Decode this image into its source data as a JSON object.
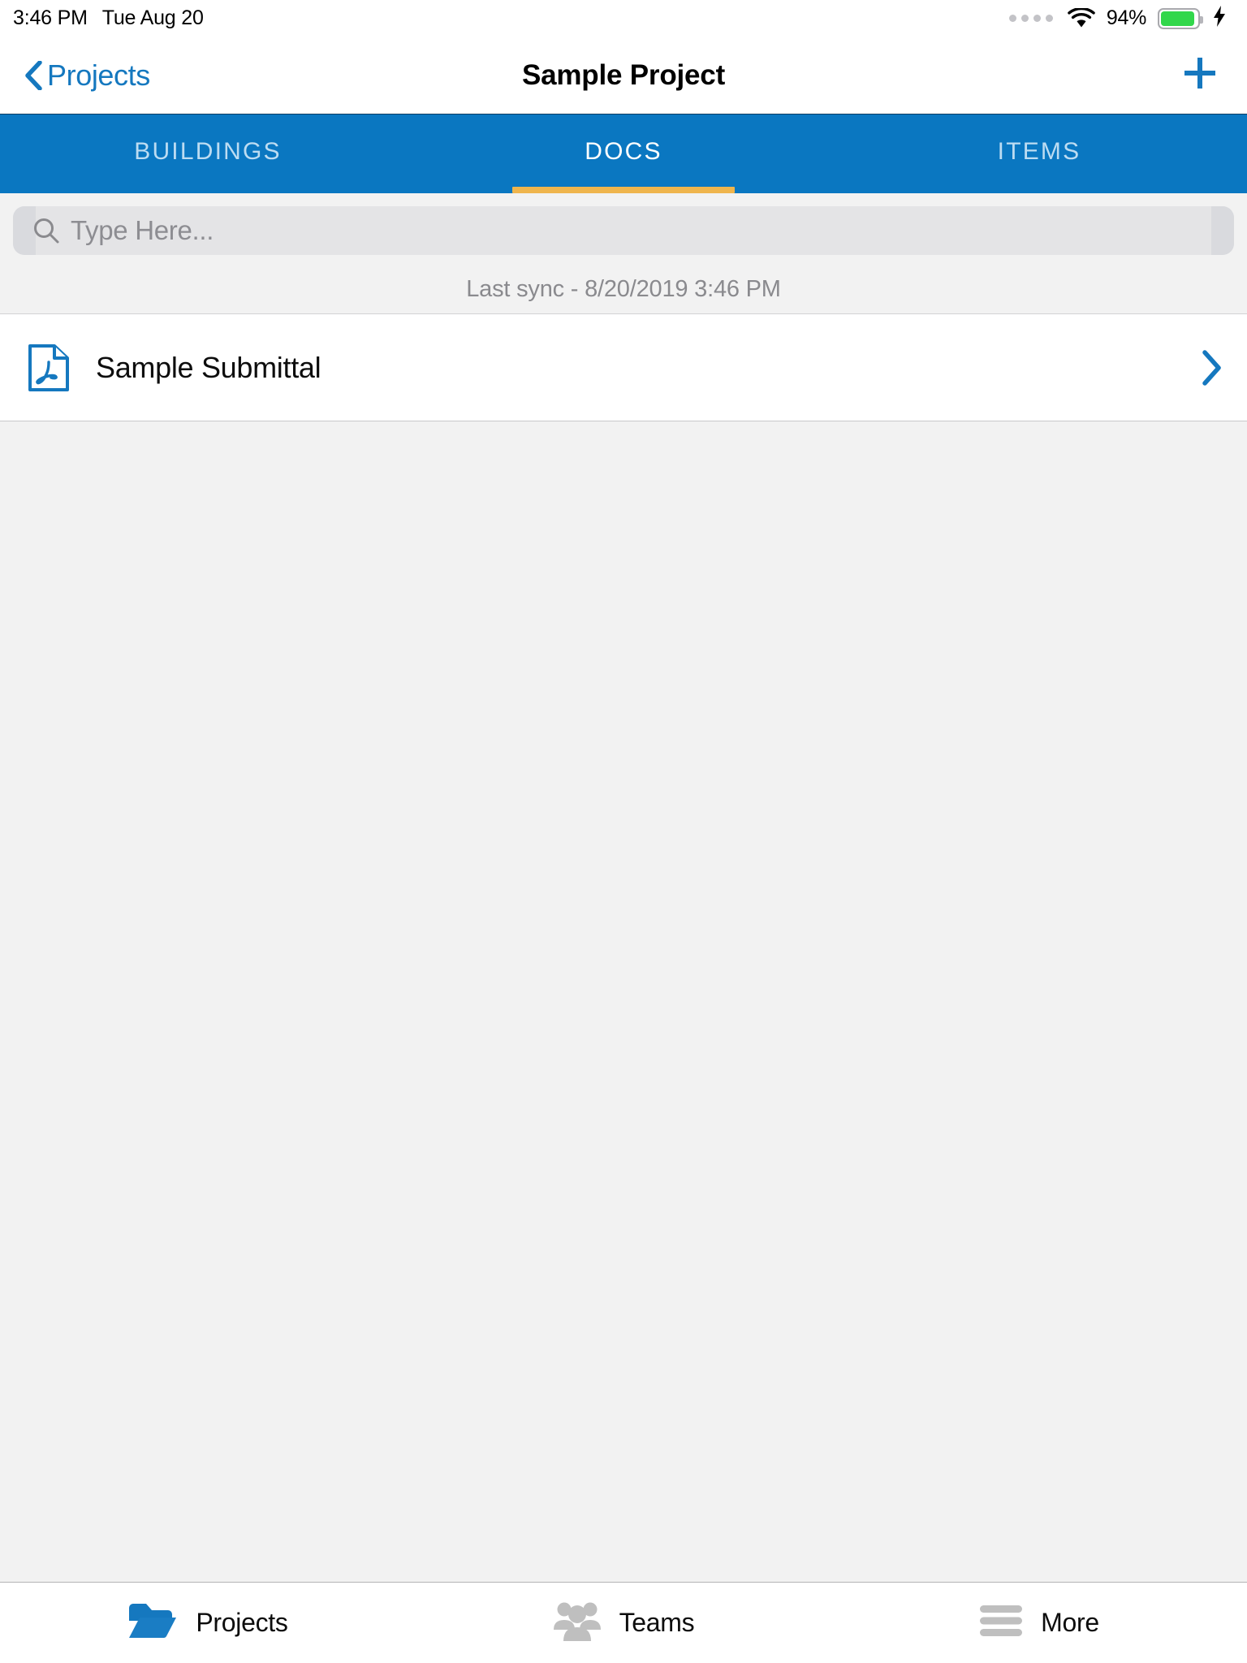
{
  "status_bar": {
    "time": "3:46 PM",
    "date": "Tue Aug 20",
    "signal_dots_icon": "signal-dots-icon",
    "wifi_icon": "wifi-icon",
    "battery_percent": "94%",
    "battery_level": 94,
    "battery_icon": "battery-icon",
    "charging_icon": "lightning-bolt-icon",
    "battery_color": "#32d74b"
  },
  "nav_bar": {
    "back_label": "Projects",
    "back_icon": "chevron-left-icon",
    "title": "Sample Project",
    "add_icon": "plus-icon",
    "accent_color": "#1578bf"
  },
  "segment_tabs": {
    "active_index": 1,
    "bar_color": "#0a77c1",
    "indicator_color": "#efb54d",
    "items": [
      {
        "label": "BUILDINGS",
        "name": "tab-buildings"
      },
      {
        "label": "DOCS",
        "name": "tab-docs"
      },
      {
        "label": "ITEMS",
        "name": "tab-items"
      }
    ]
  },
  "search": {
    "placeholder": "Type Here...",
    "value": "",
    "icon": "search-icon"
  },
  "sync": {
    "text": "Last sync - 8/20/2019 3:46 PM"
  },
  "documents": [
    {
      "title": "Sample Submittal",
      "file_icon": "pdf-file-icon",
      "disclosure_icon": "chevron-right-icon"
    }
  ],
  "bottom_tabs": {
    "active_index": 0,
    "items": [
      {
        "label": "Projects",
        "icon": "folder-open-icon",
        "name": "bottom-tab-projects"
      },
      {
        "label": "Teams",
        "icon": "people-group-icon",
        "name": "bottom-tab-teams"
      },
      {
        "label": "More",
        "icon": "hamburger-menu-icon",
        "name": "bottom-tab-more"
      }
    ]
  }
}
